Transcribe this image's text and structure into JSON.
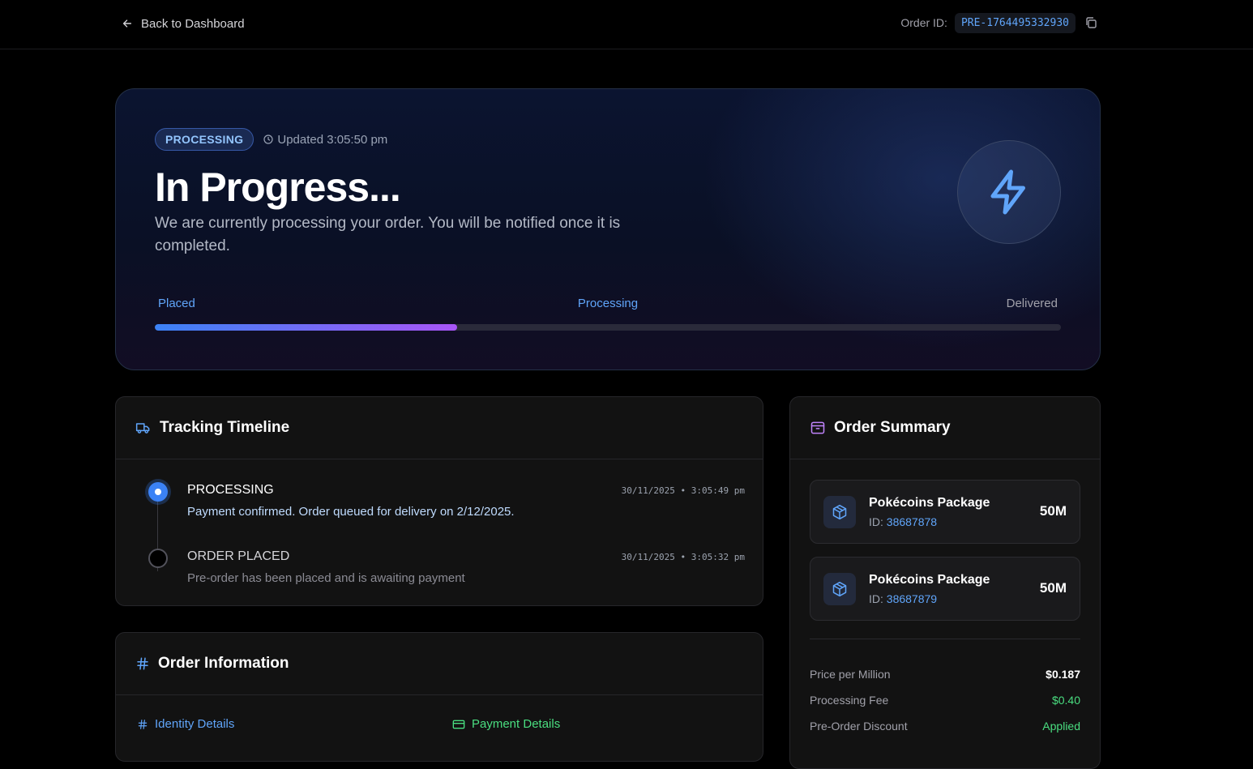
{
  "topbar": {
    "back_label": "Back to Dashboard",
    "order_id_label": "Order ID:",
    "order_id_value": "PRE-1764495332930"
  },
  "hero": {
    "status_badge": "PROCESSING",
    "updated": "Updated 3:05:50 pm",
    "title": "In Progress...",
    "description": "We are currently processing your order. You will be notified once it is completed.",
    "steps": [
      "Placed",
      "Processing",
      "Delivered"
    ],
    "progress_percent": 33.4
  },
  "timeline": {
    "title": "Tracking Timeline",
    "items": [
      {
        "status": "PROCESSING",
        "description": "Payment confirmed. Order queued for delivery on 2/12/2025.",
        "time": "30/11/2025 • 3:05:49 pm"
      },
      {
        "status": "ORDER PLACED",
        "description": "Pre-order has been placed and is awaiting payment",
        "time": "30/11/2025 • 3:05:32 pm"
      }
    ]
  },
  "info": {
    "title": "Order Information",
    "identity_label": "Identity Details",
    "payment_label": "Payment Details"
  },
  "summary": {
    "title": "Order Summary",
    "packages": [
      {
        "name": "Pokécoins Package",
        "id_label": "ID:",
        "id": "38687878",
        "qty": "50M"
      },
      {
        "name": "Pokécoins Package",
        "id_label": "ID:",
        "id": "38687879",
        "qty": "50M"
      }
    ],
    "rows": [
      {
        "label": "Price per Million",
        "value": "$0.187"
      },
      {
        "label": "Processing Fee",
        "value": "$0.40"
      },
      {
        "label": "Pre-Order Discount",
        "value": "Applied"
      }
    ]
  },
  "colors": {
    "accent_blue": "#60a5fa",
    "accent_purple": "#a855f7",
    "success_green": "#4ade80"
  }
}
